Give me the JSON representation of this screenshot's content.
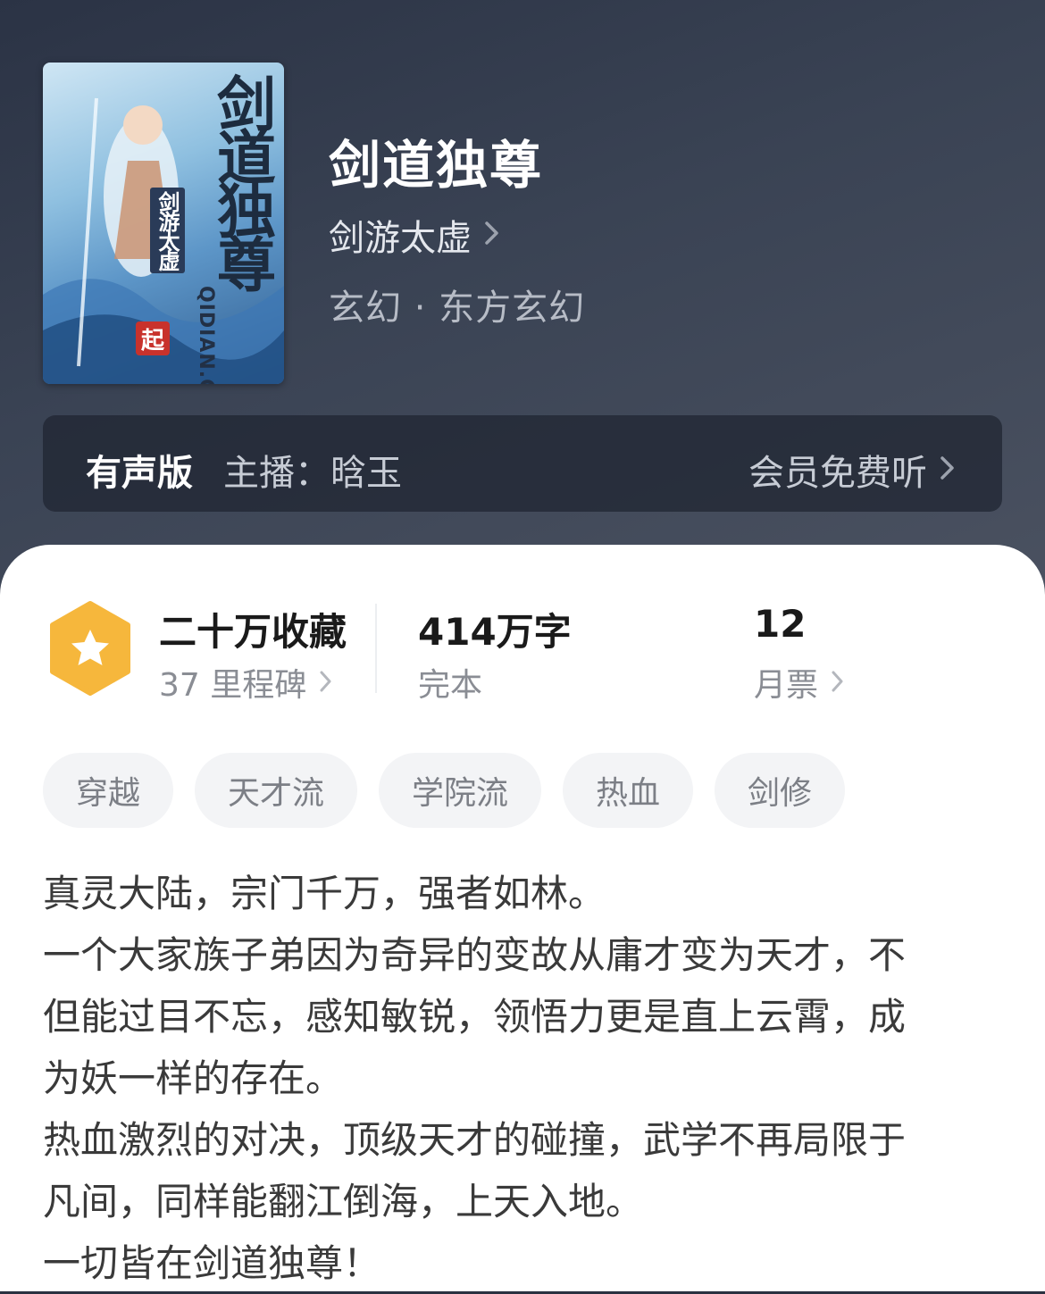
{
  "book": {
    "title": "剑道独尊",
    "author": "剑游太虚",
    "genre": "玄幻 · 东方玄幻",
    "cover": {
      "title": "剑道独尊",
      "author": "剑游太虚",
      "site": "QIDIAN.COM",
      "seal": "起"
    }
  },
  "audio": {
    "label": "有声版",
    "host": "主播：晗玉",
    "member_action": "会员免费听"
  },
  "stats": {
    "collection": {
      "main": "二十万收藏",
      "sub": "37 里程碑"
    },
    "words": {
      "main": "414万字",
      "sub": "完本"
    },
    "tickets": {
      "main": "12",
      "sub": "月票"
    }
  },
  "tags": [
    "穿越",
    "天才流",
    "学院流",
    "热血",
    "剑修"
  ],
  "description_lines": [
    "真灵大陆，宗门千万，强者如林。",
    "一个大家族子弟因为奇异的变故从庸才变为天才，不",
    "但能过目不忘，感知敏锐，领悟力更是直上云霄，成",
    "为妖一样的存在。",
    "热血激烈的对决，顶级天才的碰撞，武学不再局限于",
    "凡间，同样能翻江倒海，上天入地。",
    "一切皆在剑道独尊！"
  ],
  "colors": {
    "header_bg": "#3a4354",
    "badge": "#f6b73c",
    "tag_bg": "#f3f4f6"
  }
}
